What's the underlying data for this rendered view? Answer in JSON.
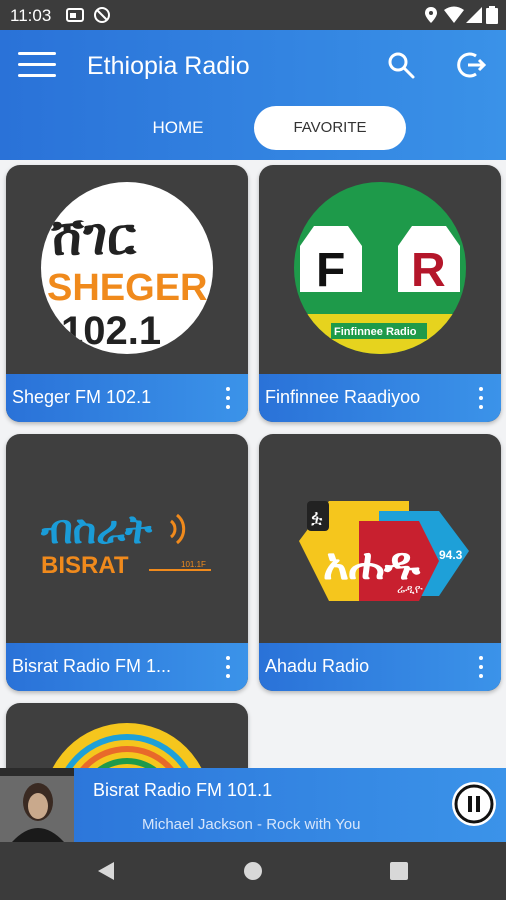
{
  "status": {
    "time": "11:03"
  },
  "appbar": {
    "title": "Ethiopia Radio"
  },
  "tabs": [
    {
      "label": "HOME"
    },
    {
      "label": "FAVORITE"
    }
  ],
  "stations": [
    {
      "name": "Sheger FM 102.1",
      "logo_text": "SHEGER",
      "logo_sub": "102.1",
      "logo_top": "ሸገር"
    },
    {
      "name": "Finfinnee Raadiyoo",
      "logo_text": "Finfinnee Radio",
      "logo_left": "F",
      "logo_right": "R"
    },
    {
      "name": "Bisrat Radio FM 1...",
      "logo_text": "BISRAT",
      "logo_freq": "101.1F",
      "logo_top": "ብስራት"
    },
    {
      "name": "Ahadu Radio",
      "logo_text": "አሐዱ",
      "logo_freq": "94.3",
      "logo_sub": "ሬዲዮ"
    }
  ],
  "player": {
    "title": "Bisrat Radio FM 101.1",
    "subtitle": "Michael Jackson - Rock with You"
  },
  "colors": {
    "accent": "#2a72d8",
    "card": "#3f3f3f"
  }
}
